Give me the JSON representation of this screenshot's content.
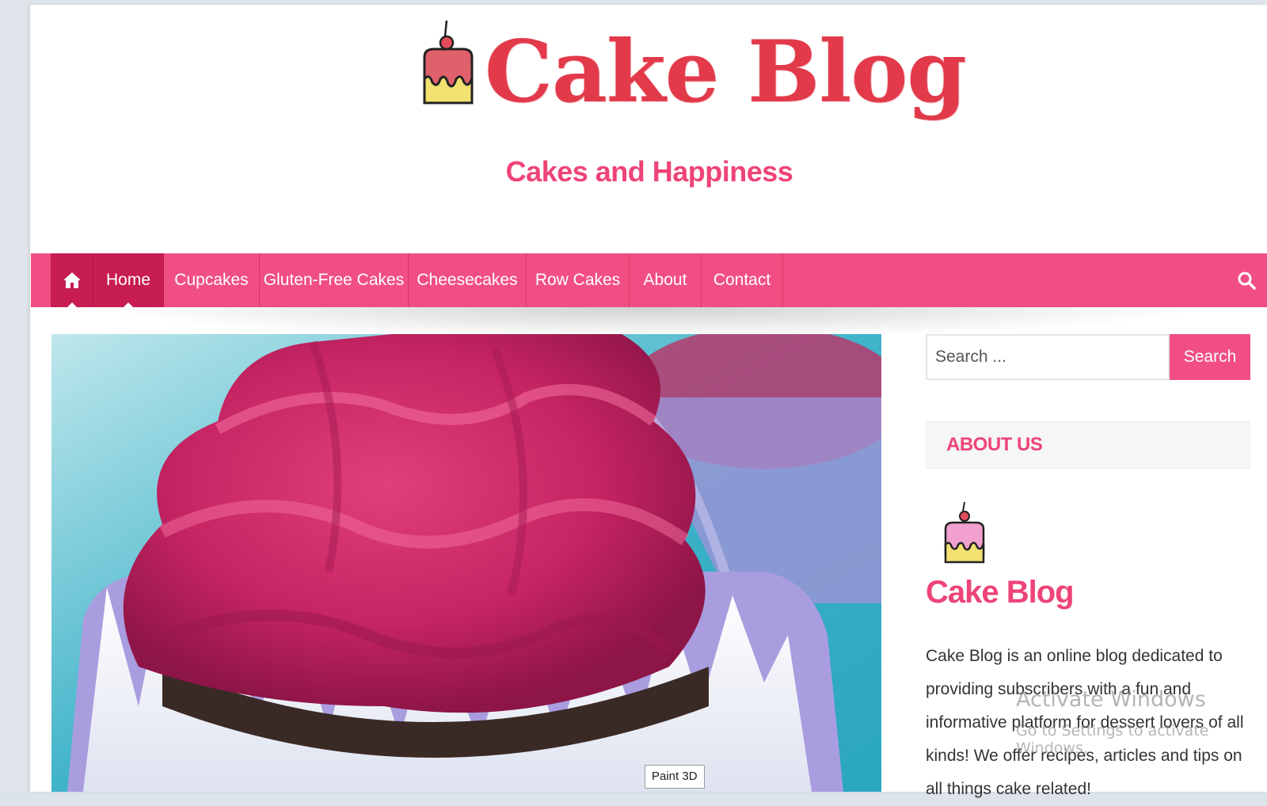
{
  "header": {
    "site_title": "Cake Blog",
    "tagline": "Cakes and Happiness"
  },
  "nav": {
    "home_icon": "home-icon",
    "items": [
      {
        "label": "Home",
        "active": true
      },
      {
        "label": "Cupcakes"
      },
      {
        "label": "Gluten-Free Cakes"
      },
      {
        "label": "Cheesecakes"
      },
      {
        "label": "Row Cakes"
      },
      {
        "label": "About"
      },
      {
        "label": "Contact"
      }
    ],
    "search_icon": "search-icon"
  },
  "hero": {
    "tooltip": "Paint 3D"
  },
  "sidebar": {
    "search_placeholder": "Search ...",
    "search_button": "Search",
    "about_heading": "ABOUT US",
    "about_title": "Cake Blog",
    "about_text": "Cake Blog is an online blog dedicated to providing subscribers with a fun and informative platform for dessert lovers of all kinds! We offer recipes, articles and tips on all things cake related!"
  },
  "watermark": {
    "line1": "Activate Windows",
    "line2": "Go to Settings to activate Windows."
  },
  "colors": {
    "accent": "#f14f83",
    "accent_dark": "#c71d50",
    "title_pink": "#ee4477",
    "logo_red": "#e23a4a"
  }
}
